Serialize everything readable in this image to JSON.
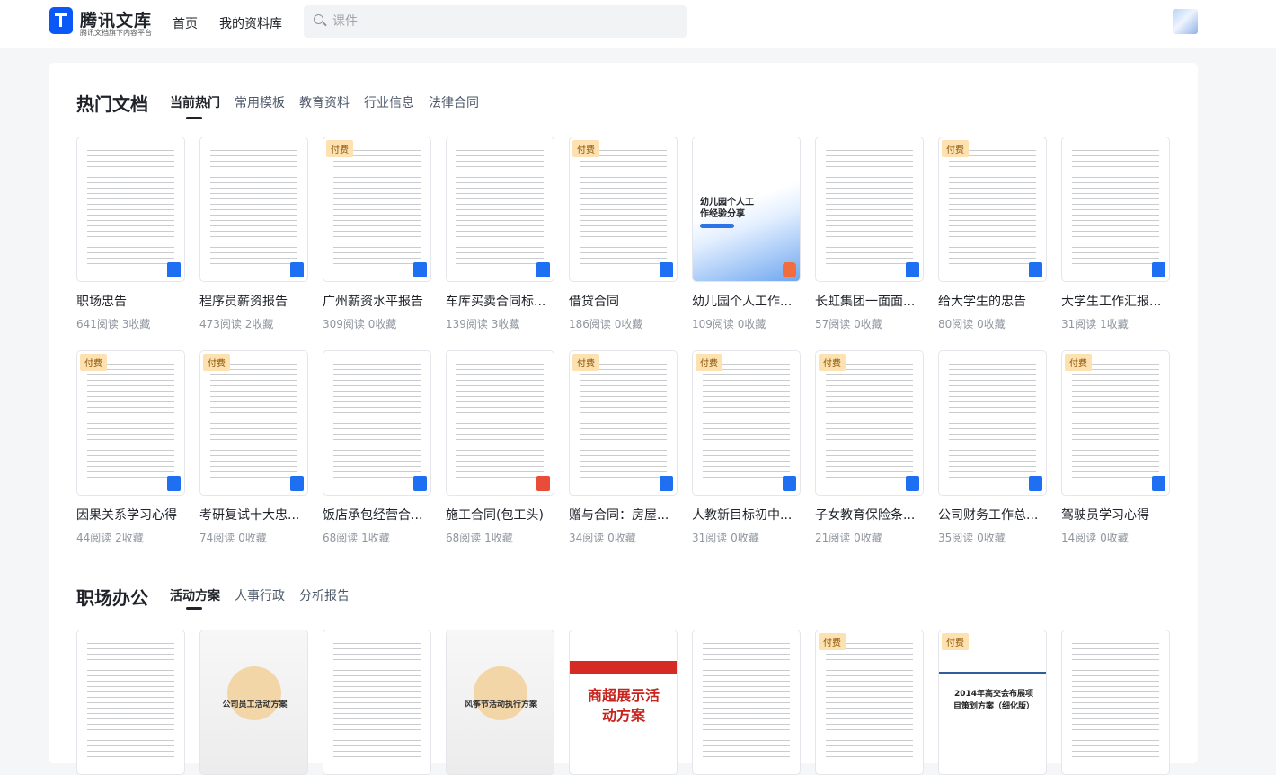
{
  "header": {
    "brand": "腾讯文库",
    "slogan": "腾讯文档旗下内容平台",
    "nav": [
      "首页",
      "我的资料库"
    ],
    "search_placeholder": "课件"
  },
  "sections": [
    {
      "title": "热门文档",
      "tabs": [
        "当前热门",
        "常用模板",
        "教育资料",
        "行业信息",
        "法律合同"
      ],
      "rows": [
        [
          {
            "title": "职场忠告",
            "reads": "641阅读",
            "favs": "3收藏",
            "paid": false,
            "type": "word"
          },
          {
            "title": "程序员薪资报告",
            "reads": "473阅读",
            "favs": "2收藏",
            "paid": false,
            "type": "word"
          },
          {
            "title": "广州薪资水平报告",
            "reads": "309阅读",
            "favs": "0收藏",
            "paid": true,
            "type": "word"
          },
          {
            "title": "车库买卖合同标...",
            "reads": "139阅读",
            "favs": "3收藏",
            "paid": false,
            "type": "word"
          },
          {
            "title": "借贷合同",
            "reads": "186阅读",
            "favs": "0收藏",
            "paid": true,
            "type": "word"
          },
          {
            "title": "幼儿园个人工作...",
            "reads": "109阅读",
            "favs": "0收藏",
            "paid": false,
            "type": "ppt"
          },
          {
            "title": "长虹集团一面面...",
            "reads": "57阅读",
            "favs": "0收藏",
            "paid": false,
            "type": "word"
          },
          {
            "title": "给大学生的忠告",
            "reads": "80阅读",
            "favs": "0收藏",
            "paid": true,
            "type": "word"
          },
          {
            "title": "大学生工作汇报...",
            "reads": "31阅读",
            "favs": "1收藏",
            "paid": false,
            "type": "word"
          }
        ],
        [
          {
            "title": "因果关系学习心得",
            "reads": "44阅读",
            "favs": "2收藏",
            "paid": true,
            "type": "word"
          },
          {
            "title": "考研复试十大忠...",
            "reads": "74阅读",
            "favs": "0收藏",
            "paid": true,
            "type": "word"
          },
          {
            "title": "饭店承包经营合...",
            "reads": "68阅读",
            "favs": "1收藏",
            "paid": false,
            "type": "word"
          },
          {
            "title": "施工合同(包工头)",
            "reads": "68阅读",
            "favs": "1收藏",
            "paid": false,
            "type": "pdf"
          },
          {
            "title": "赠与合同：房屋...",
            "reads": "34阅读",
            "favs": "0收藏",
            "paid": true,
            "type": "word"
          },
          {
            "title": "人教新目标初中...",
            "reads": "31阅读",
            "favs": "0收藏",
            "paid": true,
            "type": "word"
          },
          {
            "title": "子女教育保险条...",
            "reads": "21阅读",
            "favs": "0收藏",
            "paid": true,
            "type": "word"
          },
          {
            "title": "公司财务工作总...",
            "reads": "35阅读",
            "favs": "0收藏",
            "paid": false,
            "type": "word"
          },
          {
            "title": "驾驶员学习心得",
            "reads": "14阅读",
            "favs": "0收藏",
            "paid": true,
            "type": "word"
          }
        ]
      ]
    },
    {
      "title": "职场办公",
      "tabs": [
        "活动方案",
        "人事行政",
        "分析报告"
      ],
      "rows": [
        [
          {
            "paid": false
          },
          {
            "paid": false,
            "cover_text": "公司员工活动方案"
          },
          {
            "paid": false
          },
          {
            "paid": false,
            "cover_text": "风筝节活动执行方案"
          },
          {
            "paid": false,
            "cover_text": "商超展示活动方案"
          },
          {
            "paid": false
          },
          {
            "paid": true
          },
          {
            "paid": true,
            "cover_text": "2014年高交会布展项目策划方案（细化版）"
          },
          {
            "paid": false
          }
        ]
      ]
    }
  ],
  "labels": {
    "paid": "付费"
  },
  "cover_texts": {
    "kindergarten": "幼儿园个人工作经验分享"
  },
  "colors": {
    "accent": "#0a59f7",
    "paid_bg": "#fde1b1"
  }
}
